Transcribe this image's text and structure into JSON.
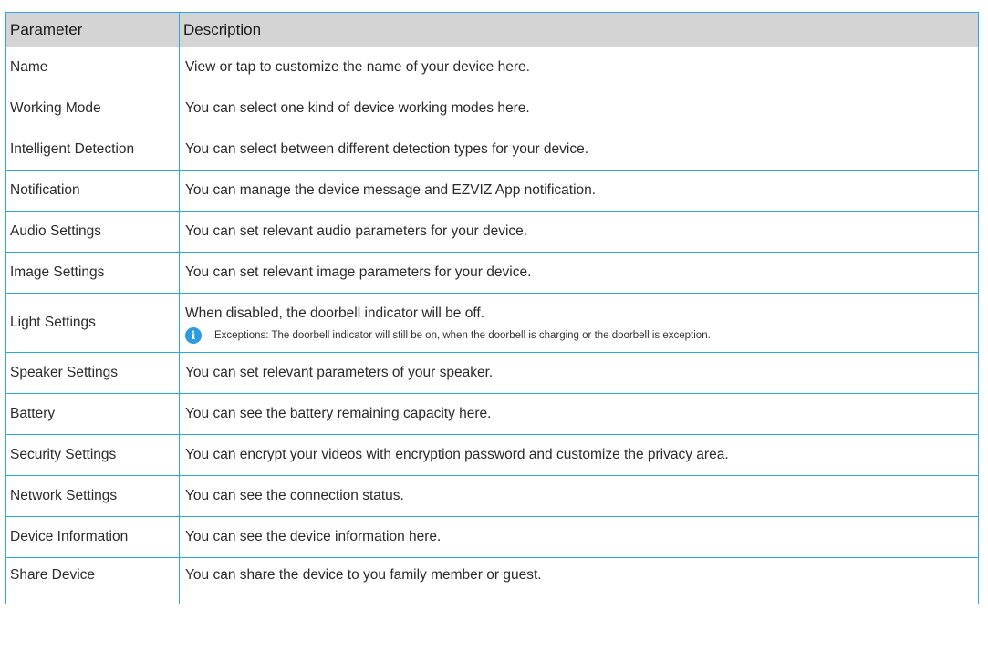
{
  "table": {
    "headers": [
      "Parameter",
      "Description"
    ],
    "rows": [
      {
        "parameter": "Name",
        "description": "View or tap to customize the name of your device here."
      },
      {
        "parameter": "Working Mode",
        "description": "You can select one kind of device working modes here."
      },
      {
        "parameter": "Intelligent Detection",
        "description": "You can select between different detection types for your device."
      },
      {
        "parameter": "Notification",
        "description": "You can manage the device message and EZVIZ App notification."
      },
      {
        "parameter": "Audio Settings",
        "description": "You can set relevant audio parameters for your device."
      },
      {
        "parameter": "Image Settings",
        "description": "You can set relevant image parameters for your device."
      },
      {
        "parameter": "Light Settings",
        "description": "When disabled, the doorbell indicator will be off.",
        "note": "Exceptions: The doorbell indicator will still be on, when the doorbell is charging or the doorbell is exception.",
        "note_icon": "info-icon"
      },
      {
        "parameter": "Speaker Settings",
        "description": "You can set relevant parameters of your speaker."
      },
      {
        "parameter": "Battery",
        "description": "You can see the battery remaining capacity here."
      },
      {
        "parameter": "Security Settings",
        "description": "You can encrypt your videos with encryption password and customize the privacy area."
      },
      {
        "parameter": "Network Settings",
        "description": "You can see the connection status."
      },
      {
        "parameter": "Device Information",
        "description": "You can see the device information here."
      },
      {
        "parameter": "Share Device",
        "description": "You can share the device to you family member or guest."
      }
    ]
  },
  "colors": {
    "border": "#29abe2",
    "header_bg": "#d4d4d4",
    "info_icon": "#2e9be0"
  }
}
